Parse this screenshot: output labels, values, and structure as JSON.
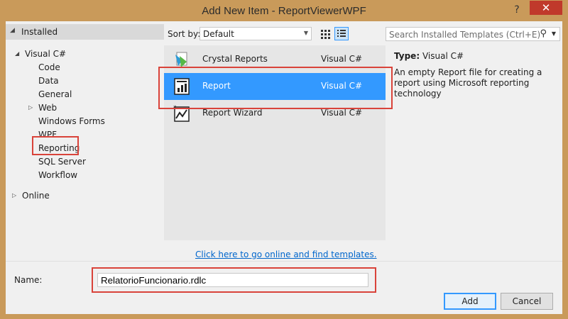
{
  "window": {
    "title": "Add New Item - ReportViewerWPF",
    "help": "?",
    "close": "✕",
    "frame_color": "#c99a5a"
  },
  "tree": {
    "installed": "Installed",
    "visual_csharp": "Visual C#",
    "items": [
      "Code",
      "Data",
      "General",
      "Web",
      "Windows Forms",
      "WPF",
      "Reporting",
      "SQL Server",
      "Workflow"
    ],
    "online": "Online"
  },
  "toolbar": {
    "sort_label": "Sort by:",
    "sort_value": "Default"
  },
  "search": {
    "placeholder": "Search Installed Templates (Ctrl+E)"
  },
  "templates": [
    {
      "name": "Crystal Reports",
      "lang": "Visual C#",
      "icon": "crystal-reports-icon"
    },
    {
      "name": "Report",
      "lang": "Visual C#",
      "icon": "report-icon",
      "selected": true
    },
    {
      "name": "Report Wizard",
      "lang": "Visual C#",
      "icon": "report-wizard-icon"
    }
  ],
  "online_link": "Click here to go online and find templates.",
  "details": {
    "type_label": "Type:",
    "type_value": "Visual C#",
    "description": "An empty Report file for creating a report using Microsoft reporting technology"
  },
  "name_field": {
    "label": "Name:",
    "value": "RelatorioFuncionario.rdlc"
  },
  "buttons": {
    "add": "Add",
    "cancel": "Cancel"
  },
  "colors": {
    "selection": "#3399ff",
    "highlight_box": "#d9433a",
    "link": "#0066cc"
  }
}
